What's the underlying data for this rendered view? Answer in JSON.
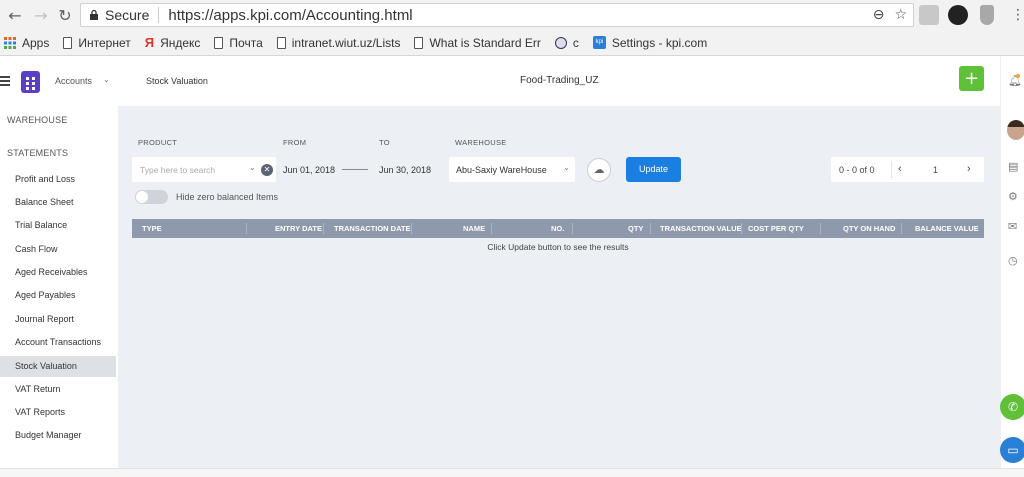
{
  "browser": {
    "secure_label": "Secure",
    "url": "https://apps.kpi.com/Accounting.html",
    "bookmarks": [
      "Apps",
      "Интернет",
      "Яндекс",
      "Почта",
      "intranet.wiut.uz/Lists",
      "What is Standard Err",
      "с",
      "Settings - kpi.com"
    ]
  },
  "header": {
    "module": "Accounts",
    "section_title": "Stock Valuation",
    "company": "Food-Trading_UZ",
    "add_label": "+"
  },
  "sidebar": {
    "top_item": "WAREHOUSE",
    "group": "STATEMENTS",
    "items": [
      {
        "label": "Profit and Loss",
        "active": false
      },
      {
        "label": "Balance Sheet",
        "active": false
      },
      {
        "label": "Trial Balance",
        "active": false
      },
      {
        "label": "Cash Flow",
        "active": false
      },
      {
        "label": "Aged Receivables",
        "active": false
      },
      {
        "label": "Aged Payables",
        "active": false
      },
      {
        "label": "Journal Report",
        "active": false
      },
      {
        "label": "Account Transactions",
        "active": false
      },
      {
        "label": "Stock Valuation",
        "active": true
      },
      {
        "label": "VAT Return",
        "active": false
      },
      {
        "label": "VAT Reports",
        "active": false
      },
      {
        "label": "Budget Manager",
        "active": false
      }
    ]
  },
  "filters": {
    "product_label": "PRODUCT",
    "product_placeholder": "Type here to search",
    "from_label": "FROM",
    "from_value": "Jun 01, 2018",
    "to_label": "TO",
    "to_value": "Jun 30, 2018",
    "warehouse_label": "WAREHOUSE",
    "warehouse_value": "Abu-Saxiy WareHouse",
    "update_label": "Update",
    "hide_zero_label": "Hide zero balanced Items"
  },
  "pager": {
    "range": "0 - 0 of 0",
    "page": "1",
    "prev": "‹",
    "next": "›"
  },
  "table": {
    "columns": [
      "TYPE",
      "ENTRY DATE",
      "TRANSACTION DATE",
      "NAME",
      "NO.",
      "QTY",
      "TRANSACTION VALUE",
      "COST PER QTY",
      "QTY ON HAND",
      "BALANCE VALUE"
    ],
    "empty_message": "Click Update button to see the results"
  },
  "icons": {
    "back": "arrow-left-icon",
    "forward": "arrow-right-icon",
    "reload": "reload-icon",
    "lock": "lock-icon",
    "zoom": "zoom-icon",
    "star": "star-icon",
    "bell": "bell-icon",
    "layout": "layout-icon",
    "gear": "gear-icon",
    "mail": "mail-icon",
    "clock": "clock-icon",
    "phone": "phone-icon",
    "chat": "chat-icon"
  },
  "colors": {
    "accent_blue": "#1a7fe0",
    "add_green": "#5fc138",
    "logo_purple": "#5b3fc4",
    "table_header": "#8e9aab",
    "panel_bg": "#eceff3"
  }
}
